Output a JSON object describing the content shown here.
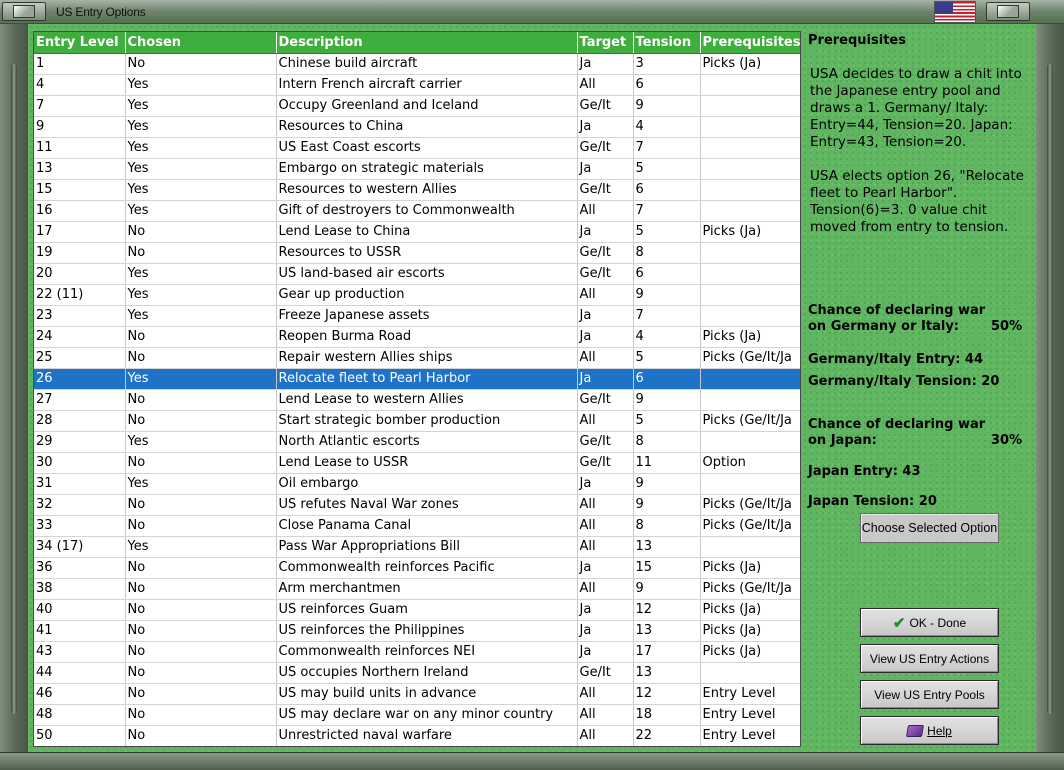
{
  "window": {
    "title": "US Entry Options"
  },
  "table": {
    "headers": [
      "Entry Level",
      "Chosen",
      "Description",
      "Target",
      "Tension",
      "Prerequisites"
    ],
    "rows": [
      [
        "1",
        "No",
        "Chinese build aircraft",
        "Ja",
        "3",
        "Picks (Ja)"
      ],
      [
        "4",
        "Yes",
        "Intern French aircraft carrier",
        "All",
        "6",
        ""
      ],
      [
        "7",
        "Yes",
        "Occupy Greenland and Iceland",
        "Ge/It",
        "9",
        ""
      ],
      [
        "9",
        "Yes",
        "Resources to China",
        "Ja",
        "4",
        ""
      ],
      [
        "11",
        "Yes",
        "US East Coast escorts",
        "Ge/It",
        "7",
        ""
      ],
      [
        "13",
        "Yes",
        "Embargo on strategic materials",
        "Ja",
        "5",
        ""
      ],
      [
        "15",
        "Yes",
        "Resources to western Allies",
        "Ge/It",
        "6",
        ""
      ],
      [
        "16",
        "Yes",
        "Gift of destroyers to Commonwealth",
        "All",
        "7",
        ""
      ],
      [
        "17",
        "No",
        "Lend Lease to China",
        "Ja",
        "5",
        "Picks (Ja)"
      ],
      [
        "19",
        "No",
        "Resources to USSR",
        "Ge/It",
        "8",
        ""
      ],
      [
        "20",
        "Yes",
        "US land-based air escorts",
        "Ge/It",
        "6",
        ""
      ],
      [
        "22 (11)",
        "Yes",
        "Gear up production",
        "All",
        "9",
        ""
      ],
      [
        "23",
        "Yes",
        "Freeze Japanese assets",
        "Ja",
        "7",
        ""
      ],
      [
        "24",
        "No",
        "Reopen Burma Road",
        "Ja",
        "4",
        "Picks (Ja)"
      ],
      [
        "25",
        "No",
        "Repair western Allies ships",
        "All",
        "5",
        "Picks (Ge/It/Ja"
      ],
      [
        "26",
        "Yes",
        "Relocate fleet to Pearl Harbor",
        "Ja",
        "6",
        ""
      ],
      [
        "27",
        "No",
        "Lend Lease to western Allies",
        "Ge/It",
        "9",
        ""
      ],
      [
        "28",
        "No",
        "Start strategic bomber production",
        "All",
        "5",
        "Picks (Ge/It/Ja"
      ],
      [
        "29",
        "Yes",
        "North Atlantic escorts",
        "Ge/It",
        "8",
        ""
      ],
      [
        "30",
        "No",
        "Lend Lease to USSR",
        "Ge/It",
        "11",
        "Option"
      ],
      [
        "31",
        "Yes",
        "Oil embargo",
        "Ja",
        "9",
        ""
      ],
      [
        "32",
        "No",
        "US refutes Naval War zones",
        "All",
        "9",
        "Picks (Ge/It/Ja"
      ],
      [
        "33",
        "No",
        "Close Panama Canal",
        "All",
        "8",
        "Picks (Ge/It/Ja"
      ],
      [
        "34 (17)",
        "Yes",
        "Pass War Appropriations Bill",
        "All",
        "13",
        ""
      ],
      [
        "36",
        "No",
        "Commonwealth reinforces Pacific",
        "Ja",
        "15",
        "Picks (Ja)"
      ],
      [
        "38",
        "No",
        "Arm merchantmen",
        "All",
        "9",
        "Picks (Ge/It/Ja"
      ],
      [
        "40",
        "No",
        "US reinforces Guam",
        "Ja",
        "12",
        "Picks (Ja)"
      ],
      [
        "41",
        "No",
        "US reinforces the Philippines",
        "Ja",
        "13",
        "Picks (Ja)"
      ],
      [
        "43",
        "No",
        "Commonwealth reinforces NEI",
        "Ja",
        "17",
        "Picks (Ja)"
      ],
      [
        "44",
        "No",
        "US occupies Northern Ireland",
        "Ge/It",
        "13",
        ""
      ],
      [
        "46",
        "No",
        "US may build units in advance",
        "All",
        "12",
        "Entry Level"
      ],
      [
        "48",
        "No",
        "US may declare war on any minor country",
        "All",
        "18",
        "Entry Level"
      ],
      [
        "50",
        "No",
        "Unrestricted naval warfare",
        "All",
        "22",
        "Entry Level"
      ]
    ],
    "selected_row": 15
  },
  "panel": {
    "heading": "Prerequisites",
    "para1": "USA decides to draw a chit into the Japanese entry pool and draws a 1.  Germany/ Italy:  Entry=44, Tension=20.  Japan:  Entry=43, Tension=20.",
    "para2": "USA elects option 26, \"Relocate fleet to Pearl Harbor\".  Tension(6)=3.  0 value chit moved from entry to tension.",
    "chance_germany_line1": "Chance of declaring war",
    "chance_germany_line2": "on Germany or Italy:",
    "chance_germany_pct": "50%",
    "germany_entry": "Germany/Italy Entry: 44",
    "germany_tension": "Germany/Italy Tension: 20",
    "chance_japan_line1": "Chance of declaring war",
    "chance_japan_line2": "on Japan:",
    "chance_japan_pct": "30%",
    "japan_entry": "Japan Entry: 43",
    "japan_tension": "Japan Tension: 20"
  },
  "buttons": {
    "choose": "Choose Selected Option",
    "ok": "OK - Done",
    "actions": "View US Entry Actions",
    "pools": "View US Entry Pools",
    "help": "Help"
  },
  "colors": {
    "header_bg": "#3fae3f",
    "selected_bg": "#1e73c8",
    "felt": "#5fb560"
  }
}
